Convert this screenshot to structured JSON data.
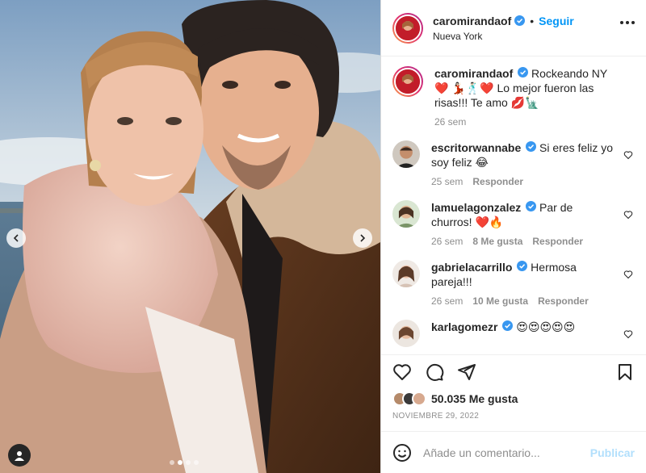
{
  "header": {
    "username": "caromirandaof",
    "separator": "•",
    "follow_label": "Seguir",
    "location": "Nueva York",
    "more_icon": "more-horizontal-icon"
  },
  "caption": {
    "username": "caromirandaof",
    "text": "Rockeando NY ❤️ 💃🏻🕺🏻❤️ Lo mejor fueron las risas!!! Te amo 💋🗽",
    "time": "26 sem"
  },
  "comments": [
    {
      "username": "escritorwannabe",
      "text": "Si eres feliz yo soy feliz 😂",
      "time": "25 sem",
      "likes": "",
      "reply": "Responder"
    },
    {
      "username": "lamuelagonzalez",
      "text": "Par de churros! ❤️🔥",
      "time": "26 sem",
      "likes": "8 Me gusta",
      "reply": "Responder"
    },
    {
      "username": "gabrielacarrillo",
      "text": "Hermosa pareja!!!",
      "time": "26 sem",
      "likes": "10 Me gusta",
      "reply": "Responder"
    },
    {
      "username": "karlagomezr",
      "text": "😍😍😍😍😍",
      "time": "",
      "likes": "",
      "reply": ""
    }
  ],
  "likes": {
    "count": "50.035",
    "label": "Me gusta"
  },
  "date": "NOVIEMBRE 29, 2022",
  "add_comment": {
    "placeholder": "Añade un comentario...",
    "publish_label": "Publicar"
  },
  "carousel": {
    "total": 4,
    "active_index": 1
  },
  "colors": {
    "accent": "#0095f6",
    "verified": "#3897f0",
    "publish_disabled": "#b2dffc",
    "heart": "#ed4956"
  }
}
